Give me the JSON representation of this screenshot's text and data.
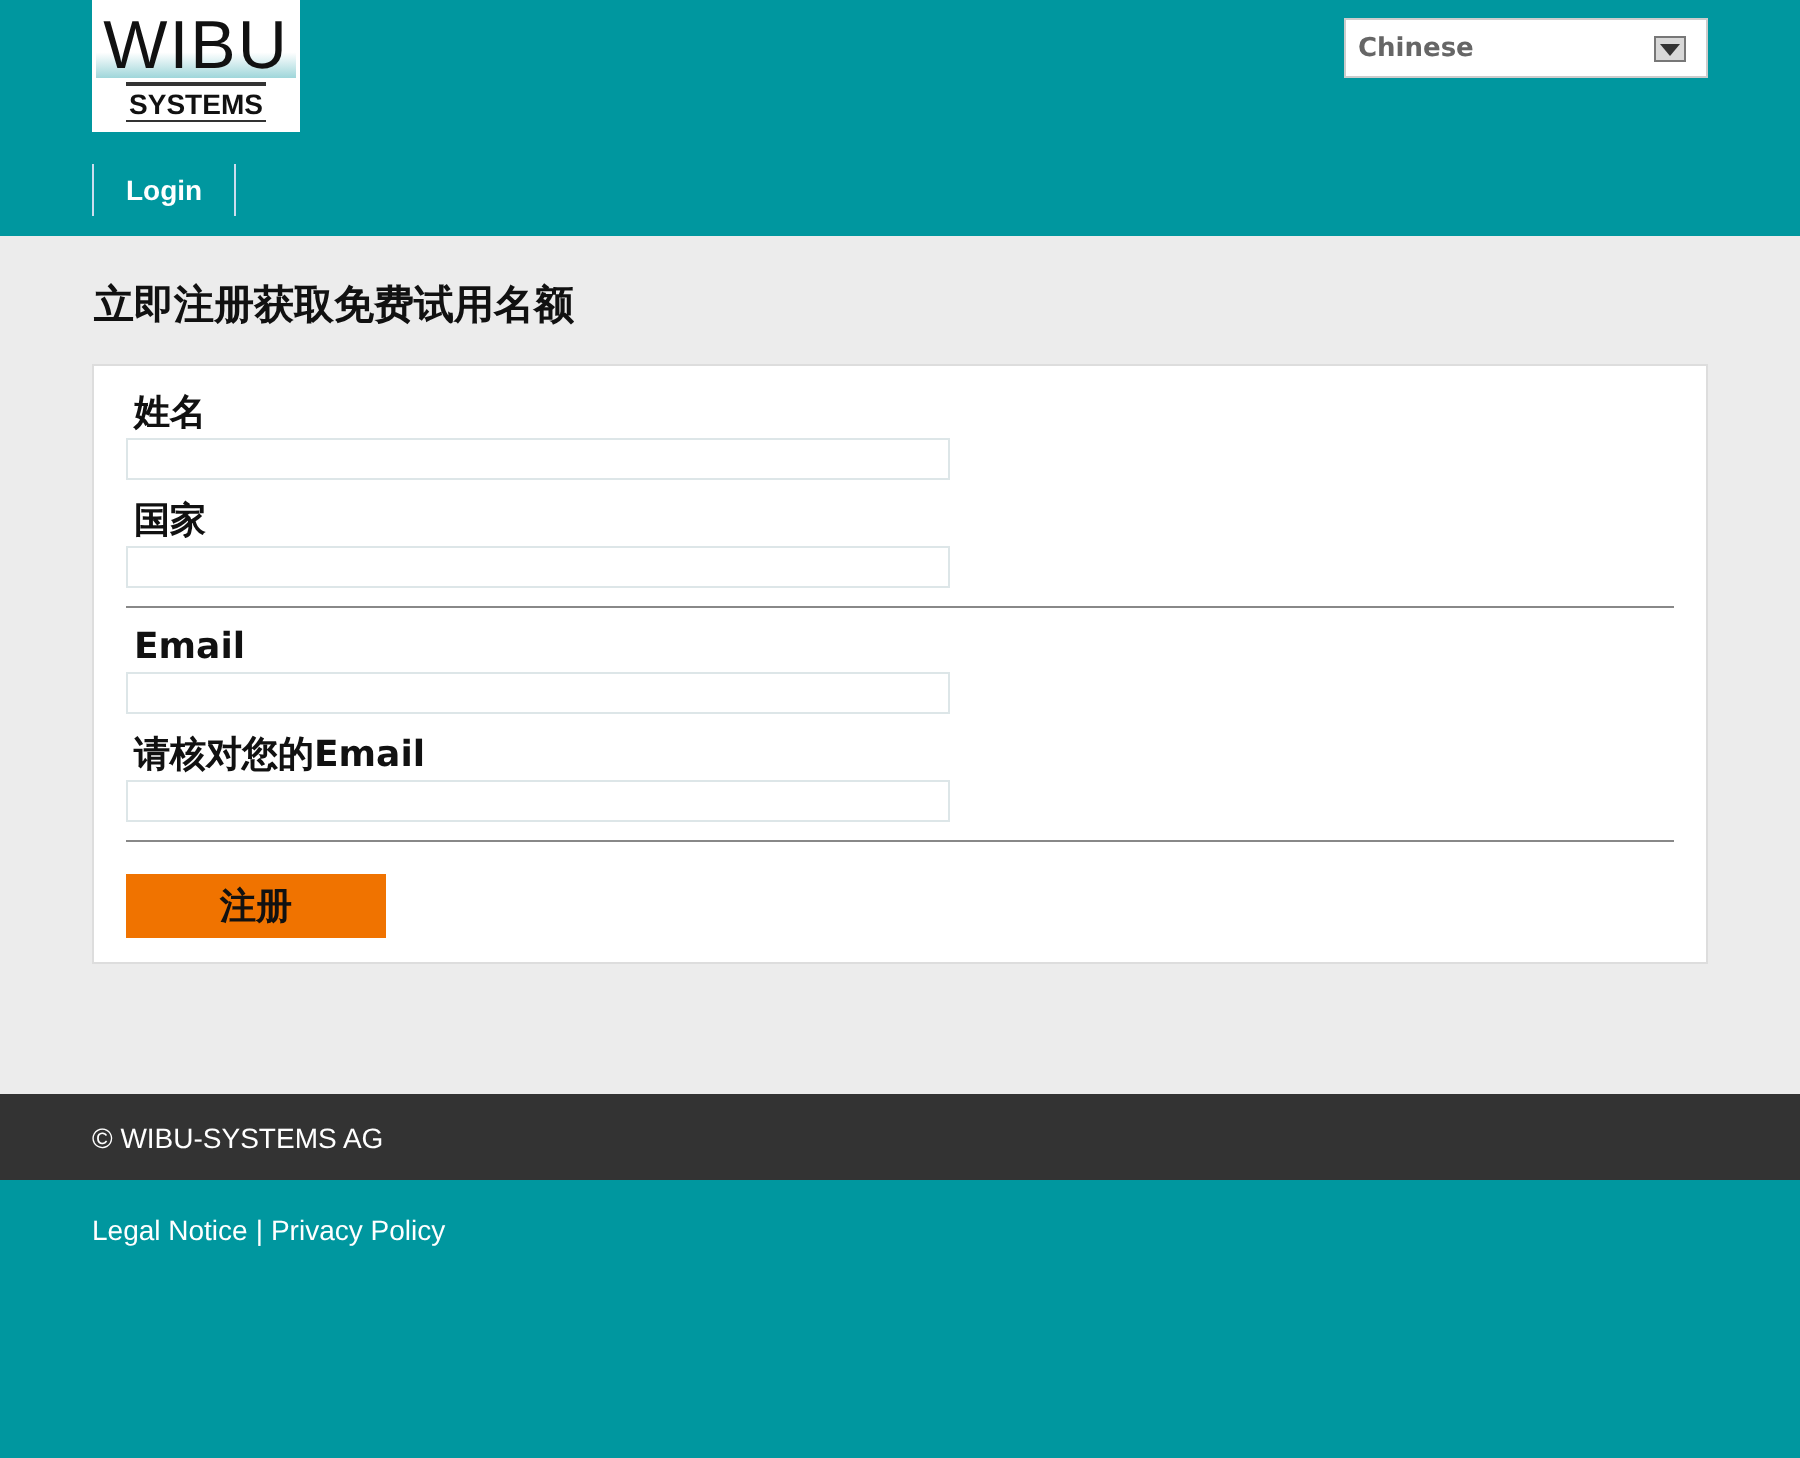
{
  "logo": {
    "top": "WIBU",
    "bottom": "SYSTEMS"
  },
  "language_select": {
    "value": "Chinese"
  },
  "nav": [
    {
      "label": "Login"
    }
  ],
  "heading": "立即注册获取免费试用名额",
  "form": {
    "sections": [
      {
        "fields": [
          {
            "label": "姓名"
          },
          {
            "label": "国家"
          }
        ]
      },
      {
        "fields": [
          {
            "label": "Email"
          },
          {
            "label": "请核对您的Email"
          }
        ]
      }
    ],
    "submit": "注册"
  },
  "footer": {
    "copyright": "© WIBU-SYSTEMS AG",
    "links": [
      {
        "label": "Legal Notice"
      },
      {
        "label": "Privacy Policy"
      }
    ],
    "separator": "|"
  }
}
